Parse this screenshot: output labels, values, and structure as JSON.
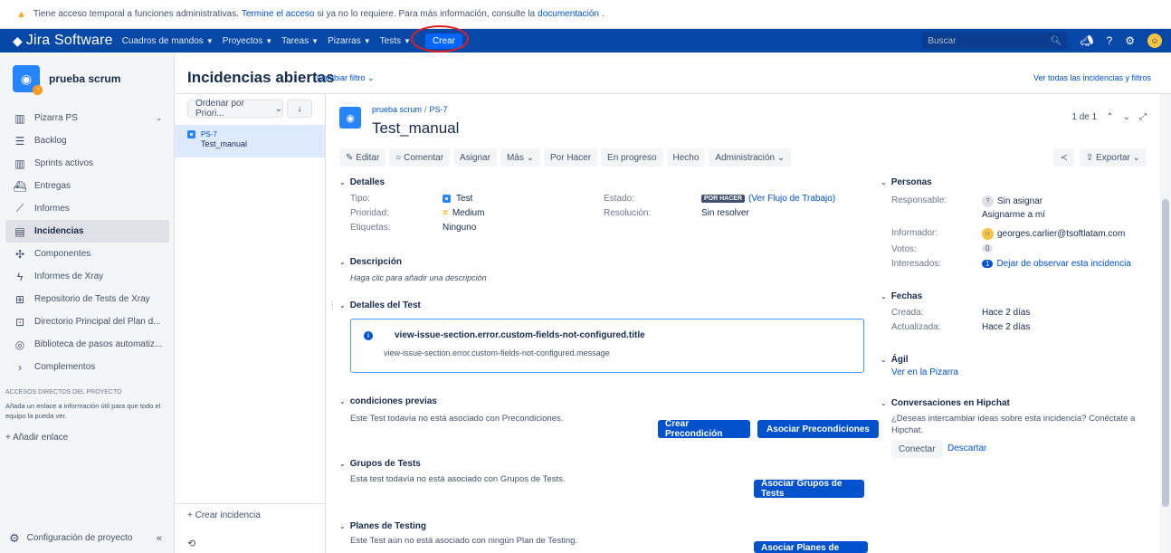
{
  "banner": {
    "text_before": "Tiene acceso temporal a funciones administrativas.",
    "link_end": "Termine el acceso",
    "text_middle": "si ya no lo requiere. Para más información, consulte la",
    "link_docs": "documentación",
    "text_after": "."
  },
  "topnav": {
    "logo": "Jira Software",
    "items": [
      "Cuadros de mandos",
      "Proyectos",
      "Tareas",
      "Pizarras",
      "Tests"
    ],
    "create": "Crear",
    "search_placeholder": "Buscar"
  },
  "sidebar": {
    "project_name": "prueba scrum",
    "items": [
      {
        "label": "Pizarra PS",
        "icon": "board-icon"
      },
      {
        "label": "Backlog",
        "icon": "backlog-icon"
      },
      {
        "label": "Sprints activos",
        "icon": "sprint-icon"
      },
      {
        "label": "Entregas",
        "icon": "ship-icon"
      },
      {
        "label": "Informes",
        "icon": "chart-icon"
      },
      {
        "label": "Incidencias",
        "icon": "issues-icon"
      },
      {
        "label": "Componentes",
        "icon": "puzzle-icon"
      },
      {
        "label": "Informes de Xray",
        "icon": "xray-icon"
      },
      {
        "label": "Repositorio de Tests de Xray",
        "icon": "repo-icon"
      },
      {
        "label": "Directorio Principal del Plan d...",
        "icon": "plan-icon"
      },
      {
        "label": "Biblioteca de pasos automatiz...",
        "icon": "library-icon"
      },
      {
        "label": "Complementos",
        "icon": "chevron-right-icon"
      }
    ],
    "shortcuts_title": "ACCESOS DIRECTOS DEL PROYECTO",
    "shortcuts_desc": "Añada un enlace a información útil para que todo el equipo la pueda ver.",
    "add_link": "+ Añadir enlace",
    "settings": "Configuración de proyecto"
  },
  "header": {
    "title": "Incidencias abiertas",
    "change_filter": "Cambiar filtro",
    "view_all": "Ver todas las incidencias y filtros"
  },
  "list": {
    "order": "Ordenar por Priori...",
    "items": [
      {
        "key": "PS-7",
        "summary": "Test_manual"
      }
    ],
    "create_issue": "+ Crear incidencia"
  },
  "issue": {
    "project": "prueba scrum",
    "key": "PS-7",
    "title": "Test_manual",
    "pager": "1 de 1",
    "toolbar": {
      "edit": "Editar",
      "comment": "Comentar",
      "assign": "Asignar",
      "more": "Más",
      "todo": "Por Hacer",
      "in_progress": "En progreso",
      "done": "Hecho",
      "admin": "Administración",
      "export": "Exportar"
    },
    "details": {
      "heading": "Detalles",
      "type_label": "Tipo:",
      "type_value": "Test",
      "priority_label": "Prioridad:",
      "priority_value": "Medium",
      "labels_label": "Etiquetas:",
      "labels_value": "Ninguno",
      "status_label": "Estado:",
      "status_value": "POR HACER",
      "workflow_link": "(Ver Flujo de Trabajo)",
      "resolution_label": "Resolución:",
      "resolution_value": "Sin resolver"
    },
    "description": {
      "heading": "Descripción",
      "hint": "Haga clic para añadir una descripción"
    },
    "test_details": {
      "heading": "Detalles del Test",
      "msg_title": "view-issue-section.error.custom-fields-not-configured.title",
      "msg_text": "view-issue-section.error.custom-fields-not-configured.message"
    },
    "preconditions": {
      "heading": "condiciones previas",
      "text": "Este Test todavía no está asociado con Precondiciones.",
      "create_btn": "Crear Precondición",
      "assoc_btn": "Asociar Precondiciones"
    },
    "test_groups": {
      "heading": "Grupos de Tests",
      "text": "Esta test todavía no está asociado con Grupos de Tests.",
      "assoc_btn": "Asociar Grupos de Tests"
    },
    "test_plans": {
      "heading": "Planes de Testing",
      "text": "Este Test aún no está asociado con ningún Plan de Testing.",
      "assoc_btn": "Asociar Planes de Testing"
    }
  },
  "people": {
    "heading": "Personas",
    "assignee_label": "Responsable:",
    "assignee_value": "Sin asignar",
    "assign_me": "Asignarme a mí",
    "reporter_label": "Informador:",
    "reporter_value": "georges.carlier@tsoftlatam.com",
    "votes_label": "Votos:",
    "votes_value": "0",
    "watchers_label": "Interesados:",
    "watchers_count": "1",
    "watchers_link": "Dejar de observar esta incidencia"
  },
  "dates": {
    "heading": "Fechas",
    "created_label": "Creada:",
    "created_value": "Hace 2 días",
    "updated_label": "Actualizada:",
    "updated_value": "Hace 2 días"
  },
  "agile": {
    "heading": "Ágil",
    "link": "Ver en la Pizarra"
  },
  "hipchat": {
    "heading": "Conversaciones en Hipchat",
    "text": "¿Deseas intercambiar ideas sobre esta incidencia? Conéctate a Hipchat.",
    "connect": "Conectar",
    "discard": "Descartar"
  },
  "colors": {
    "nav": "#0747a6",
    "primary": "#0052cc",
    "highlight": "#e02020"
  }
}
